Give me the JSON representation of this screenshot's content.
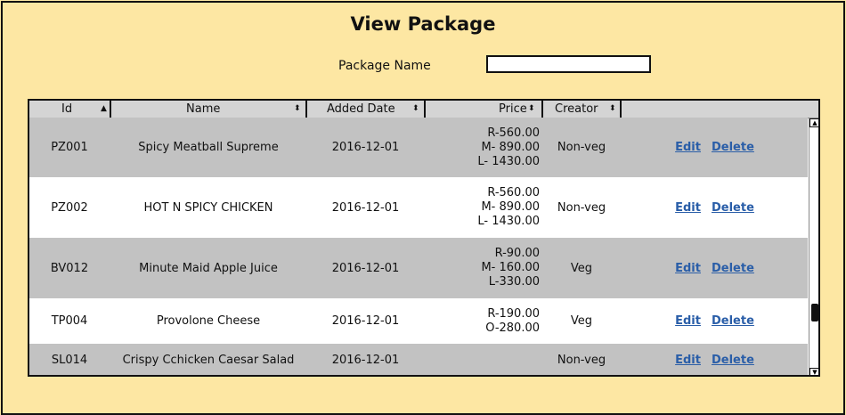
{
  "title": "View Package",
  "filter": {
    "label": "Package Name",
    "value": ""
  },
  "table": {
    "columns": [
      {
        "label": "Id",
        "sort": "▲"
      },
      {
        "label": "Name",
        "sort": "⬍"
      },
      {
        "label": "Added Date",
        "sort": "⬍"
      },
      {
        "label": "Price",
        "sort": "⬍"
      },
      {
        "label": "Creator",
        "sort": "⬍"
      }
    ],
    "rows": [
      {
        "id": "PZ001",
        "name": "Spicy Meatball Supreme",
        "date": "2016-12-01",
        "price": [
          "R-560.00",
          "M- 890.00",
          "L- 1430.00"
        ],
        "creator": "Non-veg",
        "edit": "Edit",
        "delete": "Delete"
      },
      {
        "id": "PZ002",
        "name": "HOT N SPICY CHICKEN",
        "date": "2016-12-01",
        "price": [
          "R-560.00",
          "M- 890.00",
          "L- 1430.00"
        ],
        "creator": "Non-veg",
        "edit": "Edit",
        "delete": "Delete"
      },
      {
        "id": "BV012",
        "name": "Minute Maid Apple Juice",
        "date": "2016-12-01",
        "price": [
          "R-90.00",
          "M- 160.00",
          "L-330.00"
        ],
        "creator": "Veg",
        "edit": "Edit",
        "delete": "Delete"
      },
      {
        "id": "TP004",
        "name": "Provolone Cheese",
        "date": "2016-12-01",
        "price": [
          "R-190.00",
          "O-280.00"
        ],
        "creator": "Veg",
        "edit": "Edit",
        "delete": "Delete"
      },
      {
        "id": "SL014",
        "name": "Crispy Cchicken Caesar Salad",
        "date": "2016-12-01",
        "price": [],
        "creator": "Non-veg",
        "edit": "Edit",
        "delete": "Delete"
      }
    ]
  },
  "scrollbar": {
    "up_icon": "arrow-up-icon",
    "down_icon": "arrow-down-icon"
  }
}
